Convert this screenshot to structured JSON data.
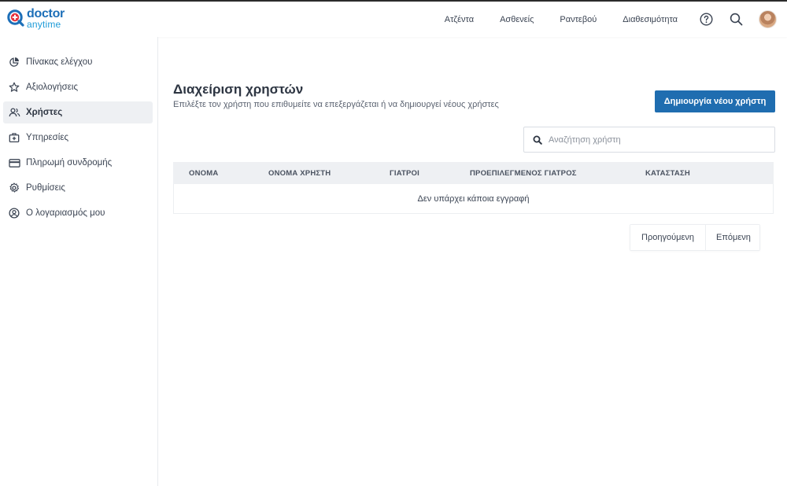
{
  "header": {
    "logo_top": "doctor",
    "logo_bottom": "anytime",
    "nav": [
      "Ατζέντα",
      "Ασθενείς",
      "Ραντεβού",
      "Διαθεσιμότητα"
    ],
    "icons": [
      "help-circle-icon",
      "search-icon",
      "avatar"
    ]
  },
  "sidebar": {
    "items": [
      {
        "label": "Πίνακας ελέγχου",
        "icon": "pie-chart-icon",
        "active": false
      },
      {
        "label": "Αξιολογήσεις",
        "icon": "star-icon",
        "active": false
      },
      {
        "label": "Χρήστες",
        "icon": "users-icon",
        "active": true
      },
      {
        "label": "Υπηρεσίες",
        "icon": "medical-bag-icon",
        "active": false
      },
      {
        "label": "Πληρωμή συνδρομής",
        "icon": "credit-card-icon",
        "active": false
      },
      {
        "label": "Ρυθμίσεις",
        "icon": "gear-icon",
        "active": false
      },
      {
        "label": "Ο λογαριασμός μου",
        "icon": "user-circle-icon",
        "active": false
      }
    ]
  },
  "main": {
    "title": "Διαχείριση χρηστών",
    "subtitle": "Επιλέξτε τον χρήστη που επιθυμείτε να επεξεργάζεται ή να δημιουργεί νέους χρήστες",
    "create_button": "Δημιουργία νέου χρήστη",
    "search_placeholder": "Αναζήτηση χρήστη",
    "table": {
      "columns": [
        "ΟΝΟΜΑ",
        "ΟΝΟΜΑ ΧΡΗΣΤΗ",
        "ΓΙΑΤΡΟΙ",
        "ΠΡΟΕΠΙΛΕΓΜΕΝΟΣ ΓΙΑΤΡΟΣ",
        "ΚΑΤΑΣΤΑΣΗ"
      ],
      "empty_message": "Δεν υπάρχει κάποια εγγραφή"
    },
    "pagination": {
      "prev": "Προηγούμενη",
      "next": "Επόμενη"
    }
  },
  "colors": {
    "primary": "#1f6db0",
    "logo_blue": "#1d6fb8",
    "logo_red": "#e5323c",
    "active_bg": "#eef0f3"
  }
}
